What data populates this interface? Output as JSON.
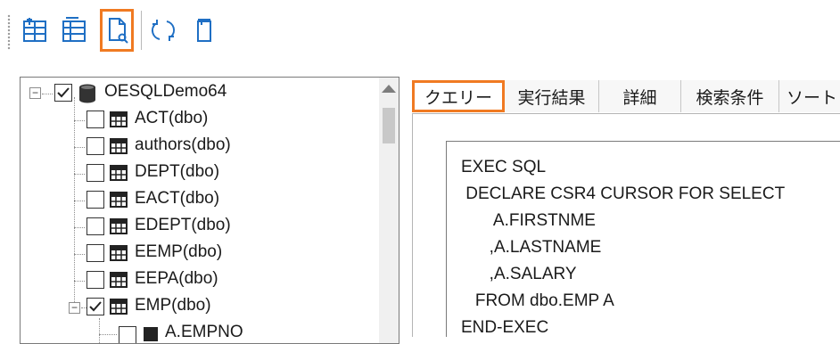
{
  "toolbar": {
    "buttons": [
      {
        "name": "grid-icon-1",
        "active": false
      },
      {
        "name": "grid-icon-2",
        "active": false
      },
      {
        "name": "document-search-icon",
        "active": true
      },
      {
        "name": "refresh-icon",
        "active": false
      },
      {
        "name": "clipboard-icon",
        "active": false
      }
    ],
    "accent": "#f07a22"
  },
  "tree": {
    "root": {
      "label": "OESQLDemo64",
      "checked": true,
      "icon": "database-icon"
    },
    "items": [
      {
        "label": "ACT(dbo)",
        "checked": false,
        "icon": "table-icon"
      },
      {
        "label": "authors(dbo)",
        "checked": false,
        "icon": "table-icon"
      },
      {
        "label": "DEPT(dbo)",
        "checked": false,
        "icon": "table-icon"
      },
      {
        "label": "EACT(dbo)",
        "checked": false,
        "icon": "table-icon"
      },
      {
        "label": "EDEPT(dbo)",
        "checked": false,
        "icon": "table-icon"
      },
      {
        "label": "EEMP(dbo)",
        "checked": false,
        "icon": "table-icon"
      },
      {
        "label": "EEPA(dbo)",
        "checked": false,
        "icon": "table-icon"
      },
      {
        "label": "EMP(dbo)",
        "checked": true,
        "icon": "table-icon"
      }
    ],
    "child_partial": {
      "label": "A.EMPNO",
      "checked": false,
      "icon": "column-icon"
    }
  },
  "tabs": [
    {
      "label": "クエリー",
      "selected": true
    },
    {
      "label": "実行結果",
      "selected": false
    },
    {
      "label": "詳細",
      "selected": false
    },
    {
      "label": "検索条件",
      "selected": false
    },
    {
      "label": "ソート",
      "selected": false
    }
  ],
  "query": {
    "lines": [
      "EXEC SQL",
      " DECLARE CSR4 CURSOR FOR SELECT",
      "       A.FIRSTNME",
      "      ,A.LASTNAME",
      "      ,A.SALARY",
      "   FROM dbo.EMP A",
      "END-EXEC"
    ]
  }
}
